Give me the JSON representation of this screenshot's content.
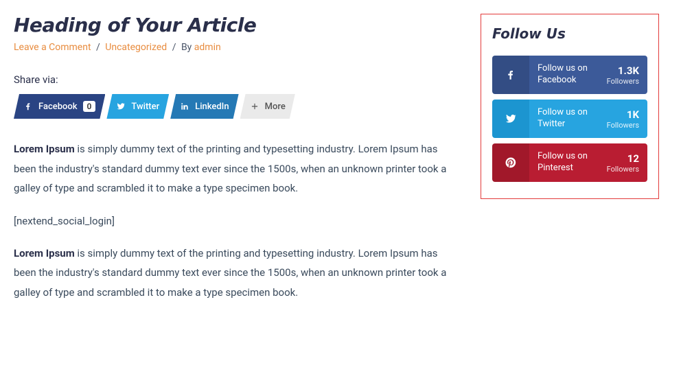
{
  "article": {
    "title": "Heading of Your Article",
    "meta": {
      "leave_comment": "Leave a Comment",
      "category": "Uncategorized",
      "by_label": "By",
      "author": "admin"
    },
    "share_via_label": "Share via:",
    "share": {
      "facebook": {
        "label": "Facebook",
        "count": "0"
      },
      "twitter": {
        "label": "Twitter"
      },
      "linkedin": {
        "label": "LinkedIn"
      },
      "more": {
        "label": "More"
      }
    },
    "paragraph1_strong": "Lorem Ipsum",
    "paragraph1_rest": " is simply dummy text of the printing and typesetting industry. Lorem Ipsum has been the industry's standard dummy text ever since the 1500s, when an unknown printer took a galley of type and scrambled it to make a type specimen book.",
    "shortcode": "[nextend_social_login]",
    "paragraph2_strong": "Lorem Ipsum",
    "paragraph2_rest": " is simply dummy text of the printing and typesetting industry. Lorem Ipsum has been the industry's standard dummy text ever since the 1500s, when an unknown printer took a galley of type and scrambled it to make a type specimen book."
  },
  "sidebar": {
    "title": "Follow Us",
    "follow": {
      "facebook": {
        "text1": "Follow us on",
        "text2": "Facebook",
        "count": "1.3K",
        "label": "Followers"
      },
      "twitter": {
        "text1": "Follow us on",
        "text2": "Twitter",
        "count": "1K",
        "label": "Followers"
      },
      "pinterest": {
        "text1": "Follow us on",
        "text2": "Pinterest",
        "count": "12",
        "label": "Followers"
      }
    }
  }
}
